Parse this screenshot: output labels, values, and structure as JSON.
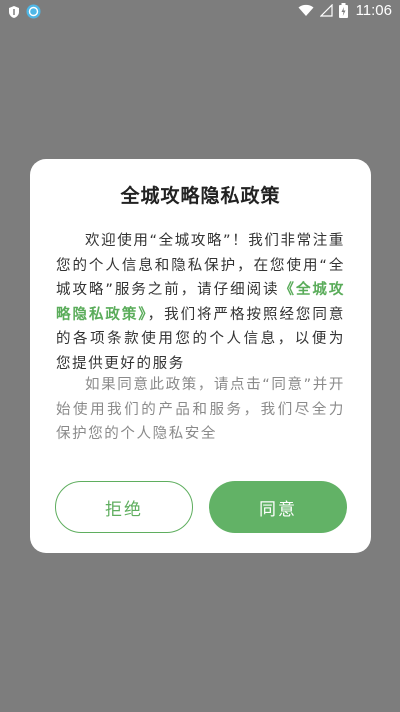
{
  "status_bar": {
    "time": "11:06",
    "left_icons": [
      "shield-icon",
      "app-notification-icon"
    ],
    "right_icons": [
      "wifi-icon",
      "cellular-signal-icon",
      "battery-charging-icon"
    ]
  },
  "dialog": {
    "title": "全城攻略隐私政策",
    "paragraph1_part1": "欢迎使用“全城攻略”！我们非常注重您的个人信息和隐私保护，在您使用“全城攻略”服务之前，请仔细阅读",
    "policy_link": "《全城攻略隐私政策》",
    "paragraph1_part2": "，我们将严格按照经您同意的各项条款使用您的个人信息，以便为您提供更好的服务",
    "paragraph2": "如果同意此政策，请点击“同意”并开始使用我们的产品和服务，我们尽全力保护您的个人隐私安全",
    "refuse_label": "拒绝",
    "agree_label": "同意"
  },
  "colors": {
    "overlay": "#7d7d7d",
    "accent_green": "#62b266",
    "link_green": "#5aac5a"
  }
}
